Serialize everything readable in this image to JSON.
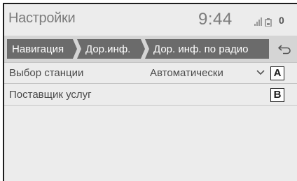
{
  "header": {
    "title": "Настройки",
    "time": "9:44",
    "status_indicator": "0"
  },
  "tabs": [
    {
      "label": "Навигация"
    },
    {
      "label": "Дор.инф."
    },
    {
      "label": "Дор. инф. по радио"
    }
  ],
  "rows": [
    {
      "label": "Выбор станции",
      "value": "Автоматически",
      "callout": "A"
    },
    {
      "label": "Поставщик услуг",
      "callout": "B"
    }
  ],
  "colors": {
    "tab_fill": "#6b6b6b",
    "background": "#ececec",
    "text": "#4a4a4a"
  },
  "icons": {
    "signal": "signal-icon",
    "battery": "battery-icon",
    "back": "back-icon",
    "chevron": "chevron-down-icon"
  }
}
